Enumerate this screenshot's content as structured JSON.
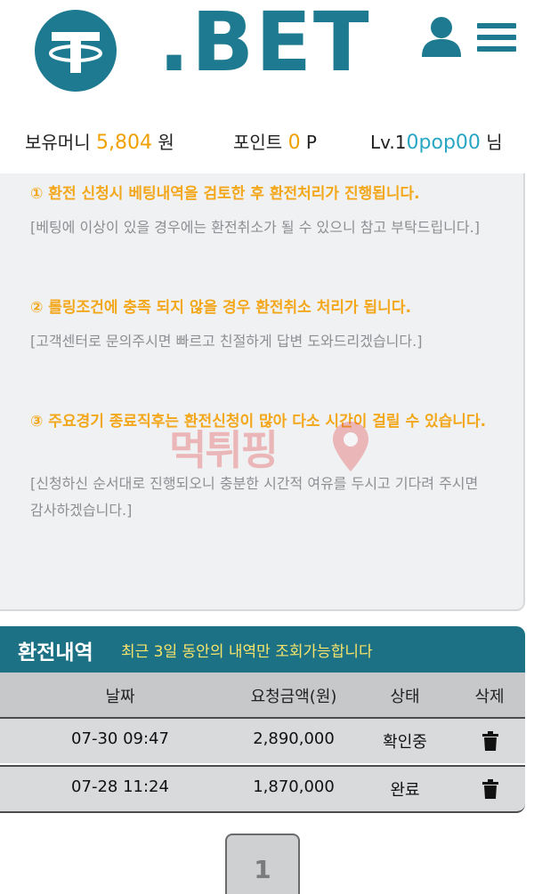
{
  "header": {
    "logo_text": ".BET"
  },
  "balance": {
    "money_label": "보유머니",
    "money_value": "5,804",
    "money_unit": "원",
    "point_label": "포인트",
    "point_value": "0",
    "point_unit": "P",
    "level": "Lv.1",
    "username": "0pop00",
    "honorific": "님"
  },
  "notices": [
    {
      "title": "① 환전 신청시 베팅내역을 검토한 후 환전처리가 진행됩니다.",
      "desc": "[베팅에 이상이 있을 경우에는 환전취소가 될 수 있으니 참고 부탁드립니다.]"
    },
    {
      "title": "② 롤링조건에 충족 되지 않을 경우 환전취소 처리가 됩니다.",
      "desc": "[고객센터로 문의주시면 빠르고 친절하게 답변 도와드리겠습니다.]"
    },
    {
      "title": "③ 주요경기 종료직후는 환전신청이 많아 다소 시간이 걸릴 수 있습니다.",
      "desc": "[신청하신 순서대로 진행되오니 충분한 시간적 여유를 두시고 기다려 주시면 감사하겠습니다.]"
    }
  ],
  "watermark": "먹튀핑",
  "history": {
    "title": "환전내역",
    "subtitle": "최근 3일 동안의 내역만 조회가능합니다",
    "columns": [
      "날짜",
      "요청금액(원)",
      "상태",
      "삭제"
    ],
    "rows": [
      {
        "date": "07-30 09:47",
        "amount": "2,890,000",
        "status": "확인중"
      },
      {
        "date": "07-28 11:24",
        "amount": "1,870,000",
        "status": "완료"
      }
    ]
  },
  "pagination": {
    "current": "1"
  },
  "colors": {
    "brand": "#1d7a90",
    "accent_orange": "#f3a71b",
    "accent_teal": "#28a6c4",
    "subtitle_yellow": "#f7e46a"
  },
  "icons": {
    "logo": "tether-logo-icon",
    "user": "user-icon",
    "menu": "hamburger-menu-icon",
    "delete": "trash-icon"
  }
}
